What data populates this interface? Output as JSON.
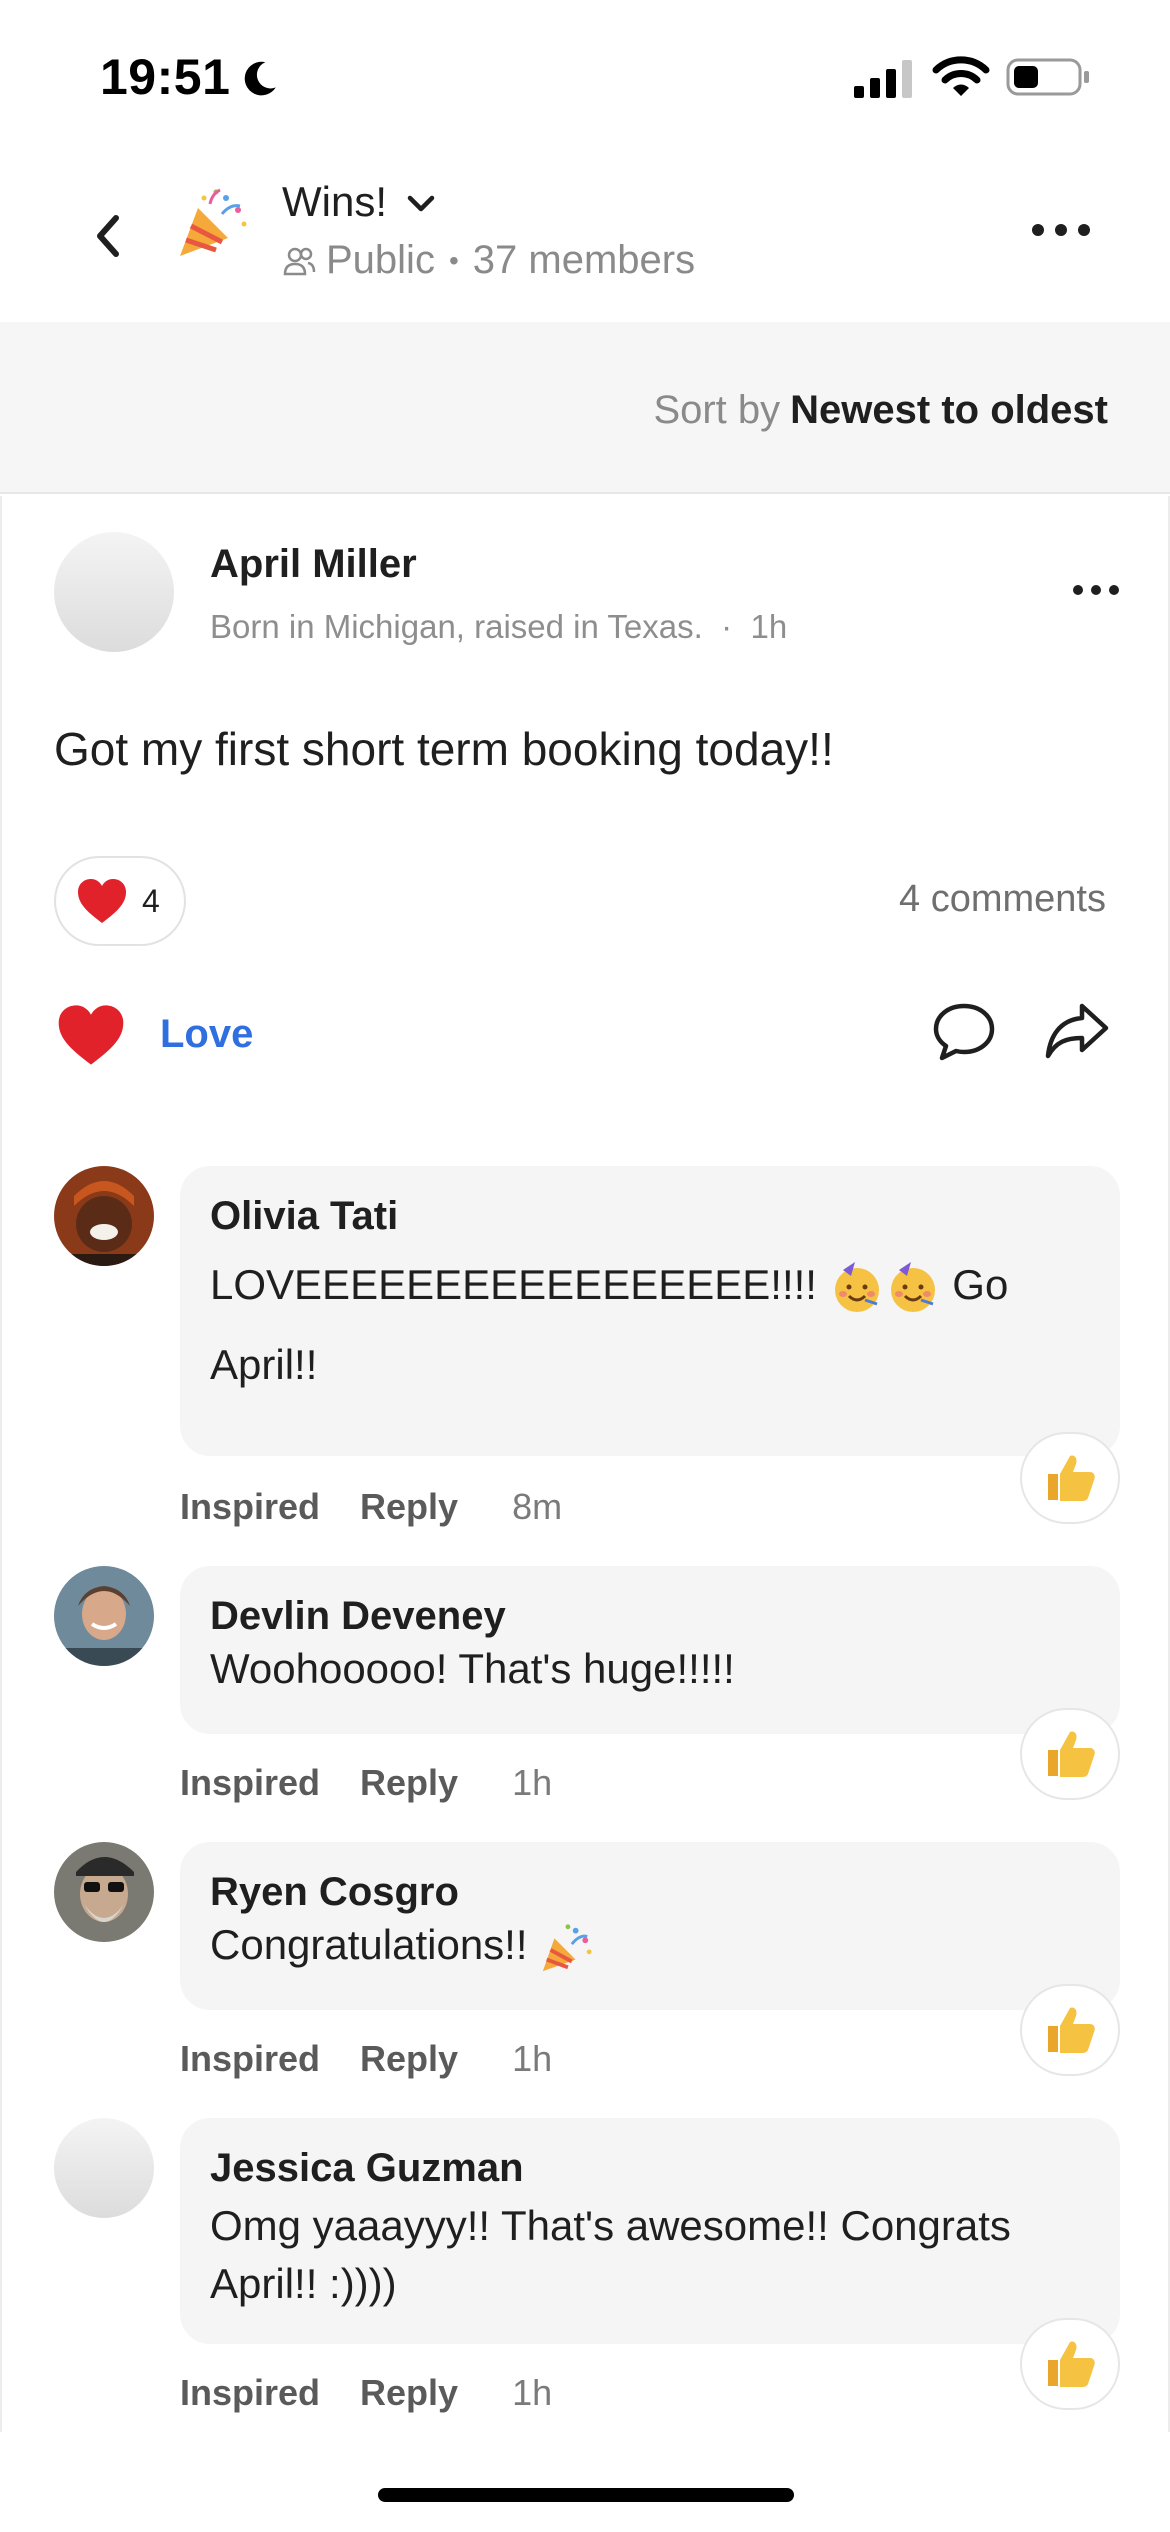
{
  "status_bar": {
    "time": "19:51"
  },
  "header": {
    "title": "Wins!",
    "visibility": "Public",
    "members": "37 members"
  },
  "sort": {
    "label": "Sort by",
    "value": "Newest to oldest"
  },
  "post": {
    "author": "April Miller",
    "bio": "Born in Michigan, raised in Texas.",
    "time": "1h",
    "body": "Got my first short term booking today!!",
    "reaction_count": "4",
    "comments_count": "4 comments",
    "love_label": "Love"
  },
  "comments": [
    {
      "name": "Olivia Tati",
      "text_line1": "LOVEEEEEEEEEEEEEEEEE!!!!",
      "text_line1_suffix": "Go",
      "text_line2": "April!!",
      "inspired": "Inspired",
      "reply": "Reply",
      "time": "8m"
    },
    {
      "name": "Devlin Deveney",
      "text": "Woohooooo! That's huge!!!!!",
      "inspired": "Inspired",
      "reply": "Reply",
      "time": "1h"
    },
    {
      "name": "Ryen Cosgro",
      "text": "Congratulations!!",
      "inspired": "Inspired",
      "reply": "Reply",
      "time": "1h"
    },
    {
      "name": "Jessica Guzman",
      "text_line1": "Omg yaaayyy!! That's awesome!! Congrats",
      "text_line2": "April!! :))))",
      "inspired": "Inspired",
      "reply": "Reply",
      "time": "1h"
    }
  ],
  "colors": {
    "accent_blue": "#2f6fe0",
    "heart_red": "#e2222b",
    "thumb_yellow": "#f5c242"
  }
}
